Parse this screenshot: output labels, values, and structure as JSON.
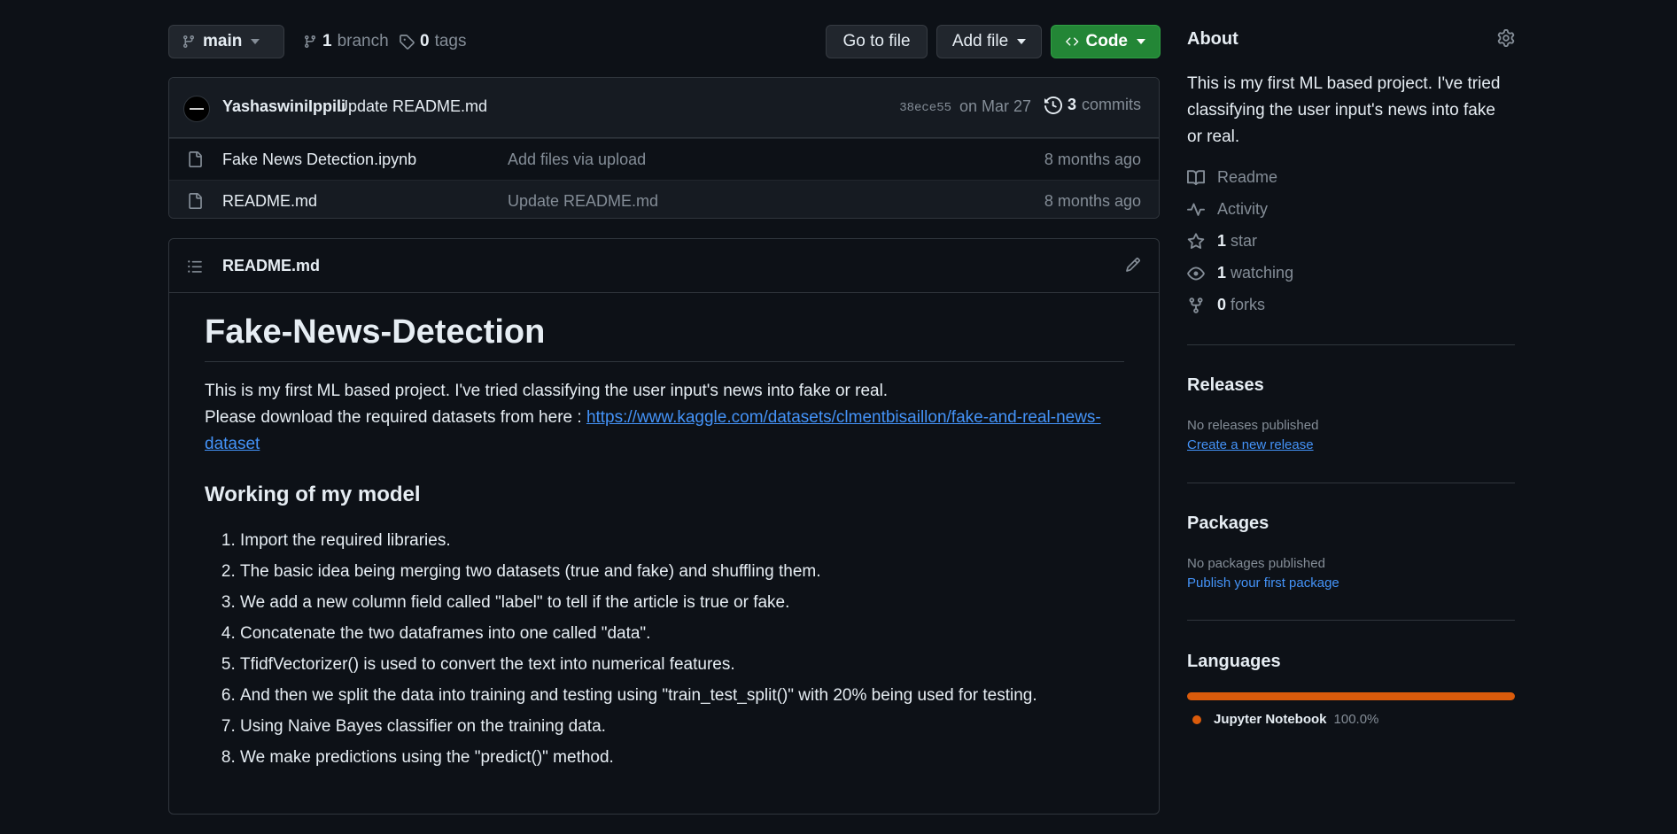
{
  "branch": {
    "name": "main",
    "branch_count": "1",
    "branch_label": "branch",
    "tag_count": "0",
    "tag_label": "tags"
  },
  "actions": {
    "goto_file": "Go to file",
    "add_file": "Add file",
    "code": "Code"
  },
  "commit": {
    "author": "YashaswiniIppili",
    "message": "Update README.md",
    "hash": "38ece55",
    "date": "on Mar 27",
    "count": "3",
    "count_label": "commits"
  },
  "files": [
    {
      "name": "Fake News Detection.ipynb",
      "message": "Add files via upload",
      "date": "8 months ago"
    },
    {
      "name": "README.md",
      "message": "Update README.md",
      "date": "8 months ago"
    }
  ],
  "readme": {
    "filename": "README.md",
    "title": "Fake-News-Detection",
    "intro": "This is my first ML based project. I've tried classifying the user input's news into fake or real.",
    "download_prefix": "Please download the required datasets from here : ",
    "download_link": "https://www.kaggle.com/datasets/clmentbisaillon/fake-and-real-news-dataset",
    "section_title": "Working of my model",
    "steps": [
      "Import the required libraries.",
      "The basic idea being merging two datasets (true and fake) and shuffling them.",
      "We add a new column field called \"label\" to tell if the article is true or fake.",
      "Concatenate the two dataframes into one called \"data\".",
      "TfidfVectorizer() is used to convert the text into numerical features.",
      "And then we split the data into training and testing using \"train_test_split()\" with 20% being used for testing.",
      "Using Naive Bayes classifier on the training data.",
      "We make predictions using the \"predict()\" method."
    ]
  },
  "about": {
    "title": "About",
    "description": "This is my first ML based project. I've tried classifying the user input's news into fake or real.",
    "readme": "Readme",
    "activity": "Activity",
    "stars_count": "1",
    "stars_label": "star",
    "watching_count": "1",
    "watching_label": "watching",
    "forks_count": "0",
    "forks_label": "forks"
  },
  "releases": {
    "title": "Releases",
    "empty": "No releases published",
    "create": "Create a new release"
  },
  "packages": {
    "title": "Packages",
    "empty": "No packages published",
    "publish": "Publish your first package"
  },
  "languages": {
    "title": "Languages",
    "items": [
      {
        "name": "Jupyter Notebook",
        "percent": "100.0%",
        "color": "#DA5B0B",
        "share": 1.0
      }
    ]
  }
}
